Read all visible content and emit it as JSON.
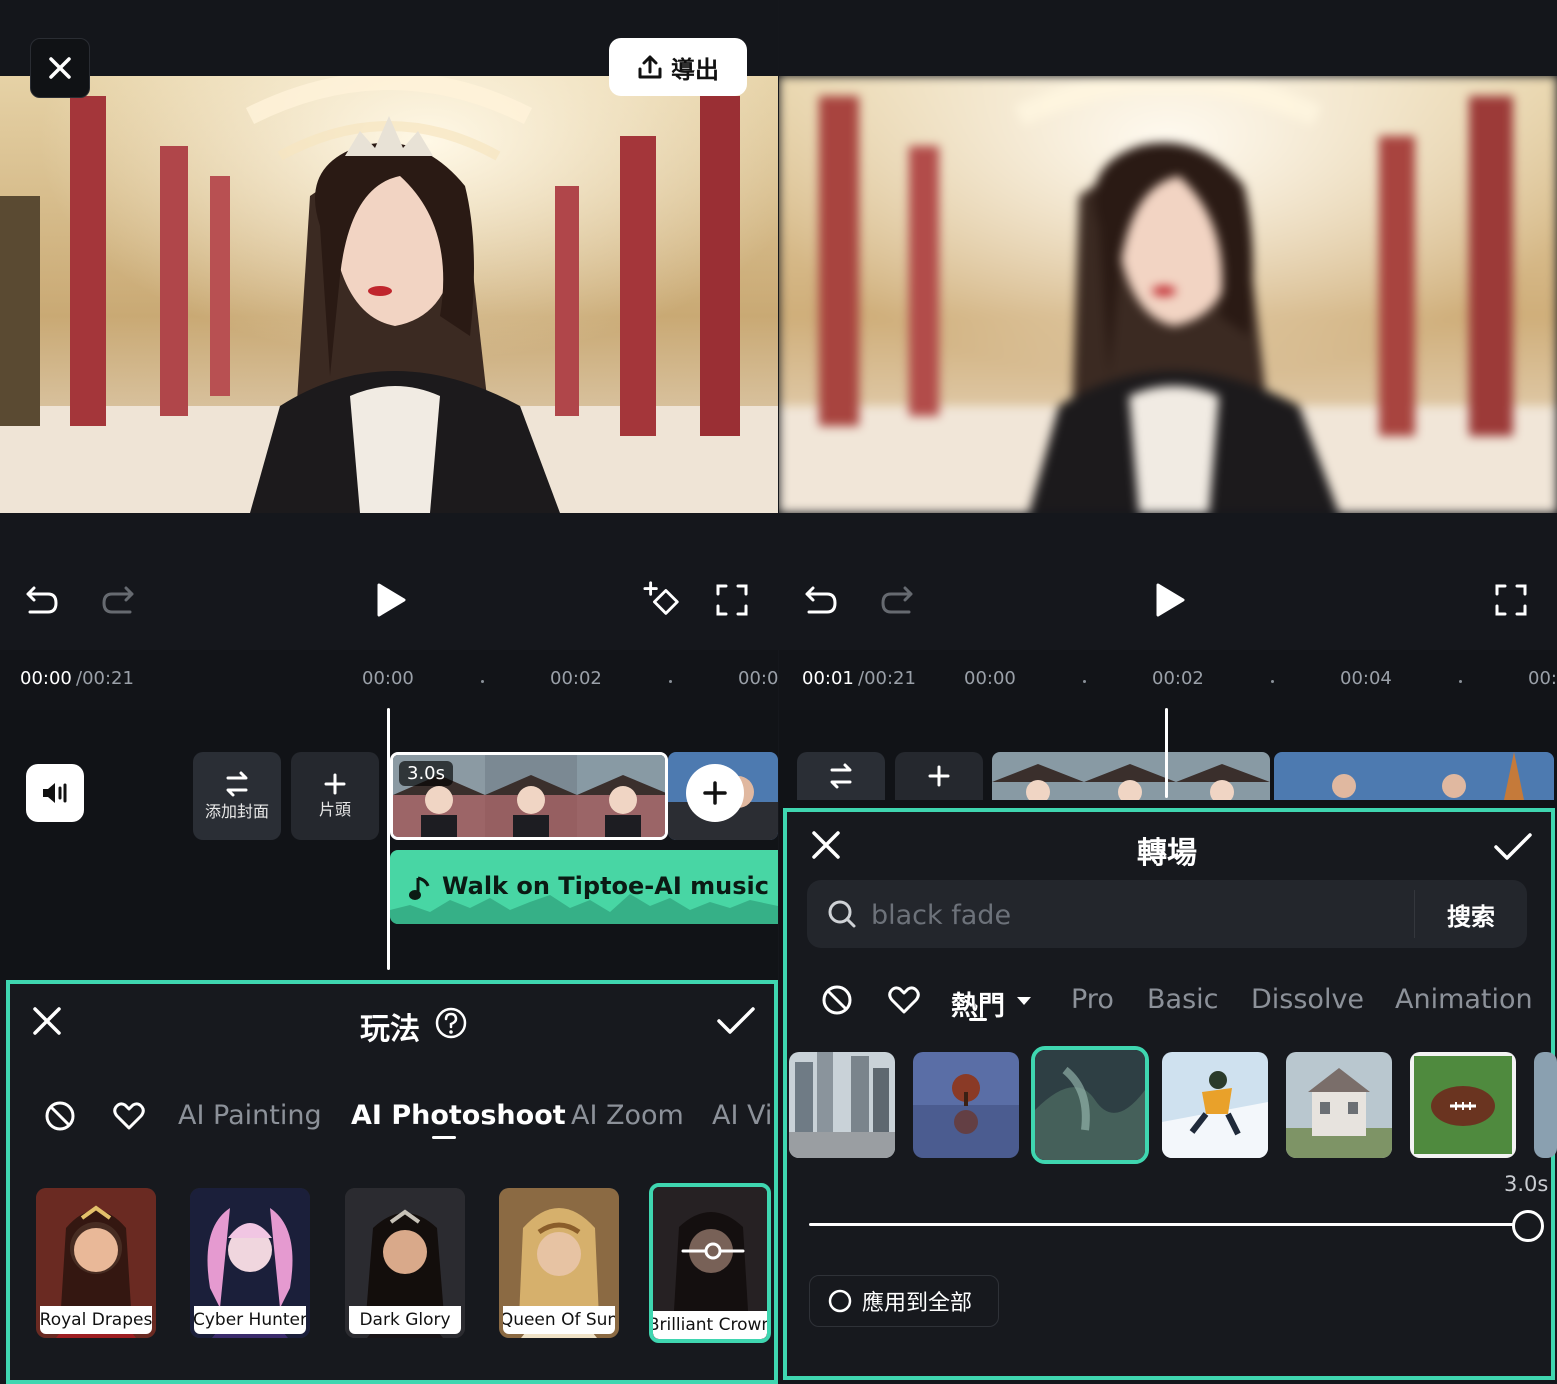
{
  "left": {
    "export_label": "導出",
    "timeline": {
      "current_time": "00:00",
      "total_time": "/00:21",
      "ticks": [
        "00:00",
        "00:02",
        "00:0"
      ]
    },
    "cover": {
      "add_cover_label": "添加封面",
      "intro_label": "片頭"
    },
    "clip_duration": "3.0s",
    "music_track": "Walk on Tiptoe-AI music",
    "panel": {
      "title": "玩法",
      "tabs": [
        "AI Painting",
        "AI Photoshoot",
        "AI Zoom",
        "AI Vi"
      ],
      "active_tab": "AI Photoshoot",
      "effects": [
        "Royal Drapes",
        "Cyber Hunter",
        "Dark Glory",
        "Queen Of Sun",
        "Brilliant Crown"
      ],
      "selected_effect": "Brilliant Crown"
    }
  },
  "right": {
    "timeline": {
      "current_time": "00:01",
      "total_time": "/00:21",
      "ticks": [
        "00:00",
        "00:02",
        "00:04",
        "00:"
      ]
    },
    "panel": {
      "title": "轉場",
      "search": {
        "placeholder": "black fade",
        "button": "搜索"
      },
      "tabs": [
        "熱門",
        "Pro",
        "Basic",
        "Dissolve",
        "Animation"
      ],
      "active_tab": "熱門",
      "duration": "3.0s",
      "duration_fraction": 1.0,
      "apply_all_label": "應用到全部"
    }
  },
  "colors": {
    "accent": "#3fd6b0",
    "music": "#48d6a4",
    "background": "#15171c"
  },
  "icons": [
    "close-icon",
    "export-icon",
    "undo-icon",
    "redo-icon",
    "play-icon",
    "keyframe-icon",
    "fullscreen-icon",
    "volume-icon",
    "help-icon",
    "check-icon",
    "none-icon",
    "heart-icon",
    "search-icon",
    "music-note-icon",
    "dropdown-icon",
    "radio-icon",
    "swap-icon",
    "plus-icon"
  ]
}
